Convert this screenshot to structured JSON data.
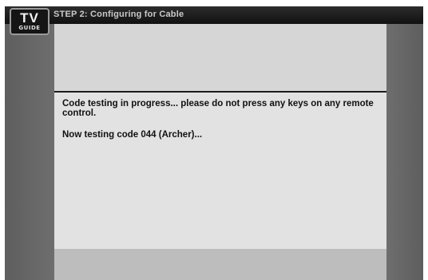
{
  "logo": {
    "tv": "TV",
    "guide": "GUIDE"
  },
  "header": {
    "title": "STEP 2: Configuring for Cable"
  },
  "dialog": {
    "message": "Code testing in progress... please do not press any keys on any remote control.",
    "status": "Now testing code 044 (Archer)..."
  },
  "colors": {
    "title_bar": "#111111",
    "background": "#646464",
    "panel": "#e2e2e2",
    "footer": "#bdbdbd",
    "text": "#111111"
  }
}
